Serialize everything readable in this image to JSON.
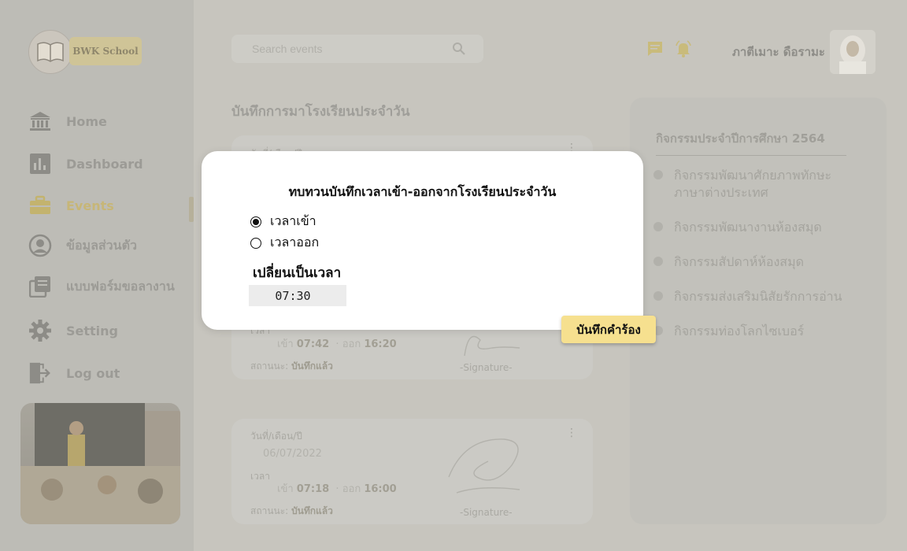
{
  "brand": {
    "name": "BWK School"
  },
  "sidebar": {
    "items": [
      {
        "label": "Home",
        "icon": "bank-icon"
      },
      {
        "label": "Dashboard",
        "icon": "bar-chart-icon"
      },
      {
        "label": "Events",
        "icon": "briefcase-icon",
        "active": true
      },
      {
        "label": "ข้อมูลส่วนตัว",
        "icon": "user-circle-icon"
      },
      {
        "label": "แบบฟอร์มขอลางาน",
        "icon": "forms-icon"
      },
      {
        "label": "Setting",
        "icon": "gear-icon"
      },
      {
        "label": "Log out",
        "icon": "logout-icon"
      }
    ]
  },
  "header": {
    "search_placeholder": "Search events",
    "user_name": "ภาตีเมาะ ดือรามะ"
  },
  "main": {
    "title": "บันทึกการมาโรงเรียนประจำวัน",
    "cards": [
      {
        "date_label": "วันที่/เดือน/ปี",
        "time_label": "เวลา",
        "in_label": "เข้า",
        "in_time": "07:42",
        "out_label": "ออก",
        "out_time": "16:20",
        "status_label": "สถานนะ:",
        "status_value": "บันทึกแล้ว",
        "signature": "-Signature-"
      },
      {
        "date_label": "วันที่/เดือน/ปี",
        "date": "06/07/2022",
        "time_label": "เวลา",
        "in_label": "เข้า",
        "in_time": "07:18",
        "out_label": "ออก",
        "out_time": "16:00",
        "status_label": "สถานนะ:",
        "status_value": "บันทึกแล้ว",
        "signature": "-Signature-"
      }
    ]
  },
  "activities": {
    "title": "กิจกรรมประจำปีการศึกษา 2564",
    "items": [
      "กิจกรรมพัฒนาศักยภาพทักษะภาษาต่างประเทศ",
      "กิจกรรมพัฒนางานห้องสมุด",
      "กิจกรรมสัปดาห์ห้องสมุด",
      "กิจกรรมส่งเสริมนิสัยรักการอ่าน",
      "กิจกรรมท่องโลกไซเบอร์"
    ]
  },
  "modal": {
    "title": "ทบทวนบันทึกเวลาเข้า-ออกจากโรงเรียนประจำวัน",
    "options": [
      {
        "label": "เวลาเข้า",
        "selected": true
      },
      {
        "label": "เวลาออก",
        "selected": false
      }
    ],
    "change_label": "เปลี่ยนเป็นเวลา",
    "time_value": "07:30",
    "submit_label": "บันทึกคำร้อง"
  },
  "colors": {
    "accent": "#f6e08f",
    "overlay": "#c7c5be",
    "modal_bg": "#ffffff"
  }
}
